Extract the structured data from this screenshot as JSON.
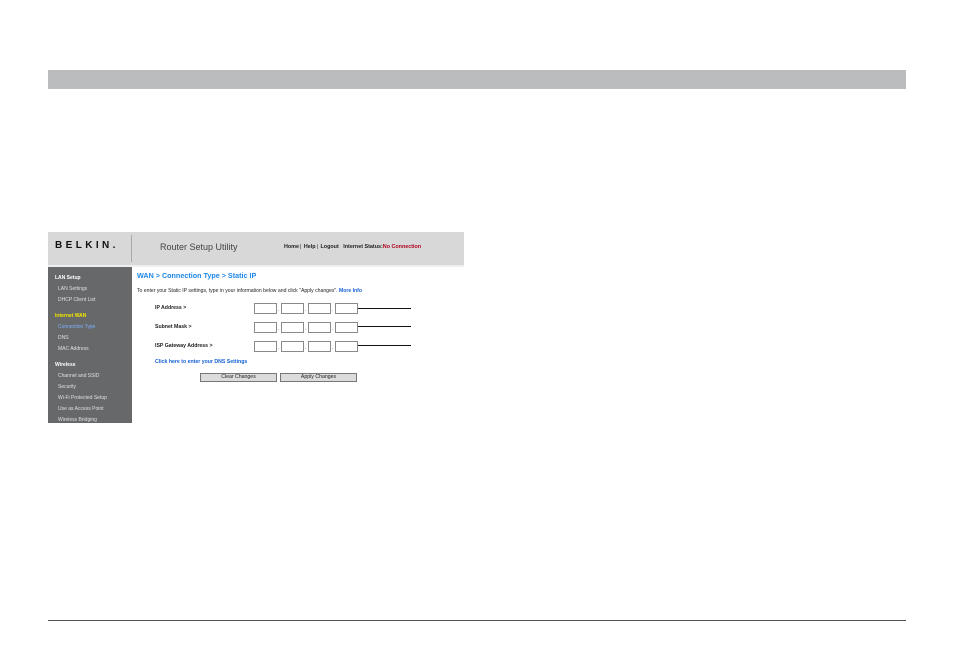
{
  "brand": {
    "logo": "BELKIN",
    "logo_dot": "."
  },
  "header": {
    "app_title": "Router Setup Utility",
    "nav": [
      "Home",
      "Help",
      "Logout"
    ],
    "separator": "|",
    "status_label": "Internet Status:",
    "status_value": "No Connection",
    "status_color": "#b00020"
  },
  "sidebar": {
    "sections": [
      {
        "title": "LAN Setup",
        "items": [
          "LAN Settings",
          "DHCP Client List"
        ]
      },
      {
        "title": "Internet WAN",
        "items": [
          "Connection Type",
          "DNS",
          "MAC Address"
        ]
      },
      {
        "title": "Wireless",
        "items": [
          "Channel and SSID",
          "Security",
          "Wi-Fi Protected Setup",
          "Use as Access Point",
          "Wireless Bridging"
        ]
      }
    ],
    "active_item": "Connection Type",
    "active_section": "Internet WAN"
  },
  "main": {
    "breadcrumb": "WAN > Connection Type > Static IP",
    "intro": "To enter your Static IP settings, type in your information below and click \"Apply changes\".",
    "more_info": "More Info",
    "fields": [
      {
        "label": "IP Address >",
        "values": [
          "",
          "",
          "",
          ""
        ]
      },
      {
        "label": "Subnet Mask >",
        "values": [
          "",
          "",
          "",
          ""
        ]
      },
      {
        "label": "ISP Gateway Address >",
        "values": [
          "",
          "",
          "",
          ""
        ]
      }
    ],
    "octet_separator": ".",
    "dns_link": "Click here to enter your DNS Settings",
    "clear_button": "Clear Changes",
    "apply_button": "Apply Changes"
  },
  "colors": {
    "accent_blue": "#1f87e5",
    "link_blue": "#1461d6",
    "sidebar_bg": "#666869",
    "sidebar_highlight": "#f2e600",
    "top_bar": "#bbbcbe"
  }
}
